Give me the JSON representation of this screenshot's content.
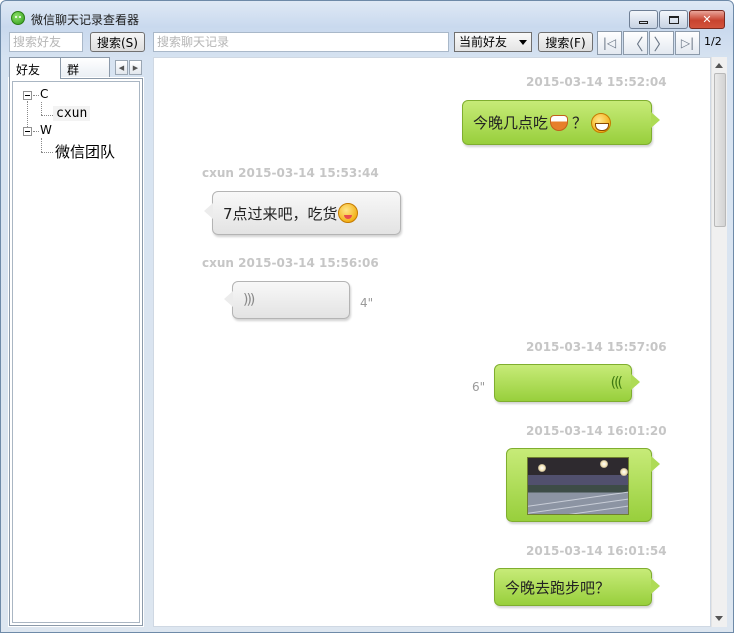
{
  "window": {
    "title": "微信聊天记录查看器",
    "controls": {
      "minimize": "",
      "maximize": "",
      "close": "✕"
    }
  },
  "toolbar": {
    "friend_search_placeholder": "搜索好友",
    "friend_search_button": "搜索(S)",
    "chat_search_placeholder": "搜索聊天记录",
    "scope_select": "当前好友",
    "chat_search_button": "搜索(F)",
    "nav": {
      "first": "|◁",
      "prev": "〈",
      "next": "〉",
      "last": "▷|"
    },
    "page_indicator": "1/2"
  },
  "sidebar": {
    "tabs": [
      {
        "label": "好友"
      },
      {
        "label": "群"
      }
    ],
    "tree": [
      {
        "group": "C",
        "children": [
          "cxun"
        ]
      },
      {
        "group": "W",
        "children": [
          "微信团队"
        ]
      }
    ]
  },
  "messages": [
    {
      "side": "right",
      "timestamp": "2015-03-14 15:52:04",
      "type": "text",
      "text": "今晚几点吃",
      "suffix": "？",
      "emojis": [
        "rice",
        "grin"
      ]
    },
    {
      "side": "left",
      "timestamp": "cxun 2015-03-14 15:53:44",
      "type": "text",
      "text": "7点过来吧，吃货",
      "emojis": [
        "yum"
      ]
    },
    {
      "side": "left",
      "timestamp": "cxun 2015-03-14 15:56:06",
      "type": "voice",
      "duration": "4\"",
      "glyph": ")))"
    },
    {
      "side": "right",
      "timestamp": "2015-03-14 15:57:06",
      "type": "voice",
      "duration": "6\"",
      "glyph": "((("
    },
    {
      "side": "right",
      "timestamp": "2015-03-14 16:01:20",
      "type": "image"
    },
    {
      "side": "right",
      "timestamp": "2015-03-14 16:01:54",
      "type": "text",
      "text": "今晚去跑步吧？"
    }
  ],
  "colors": {
    "bubble_green": "#aedb55",
    "bubble_gray": "#ececec",
    "timestamp": "#c6c6c6"
  }
}
